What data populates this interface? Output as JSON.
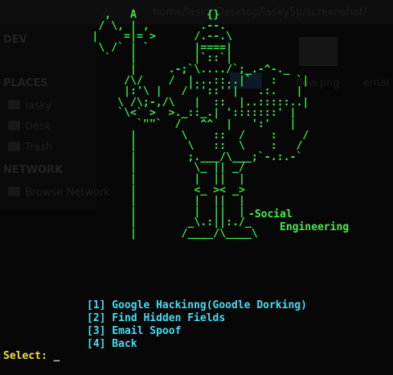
{
  "background_window": {
    "path_bar": "home/lasky/Desktop/lasky5p/screenshot/",
    "sections": [
      "DEV",
      "PLACES",
      "NETWORK"
    ],
    "items": [
      "lasky",
      "Desk",
      "Trash",
      "Browse Network"
    ],
    "files": [
      "flow.png",
      "emai"
    ]
  },
  "banner": {
    "art_lines": [
      "            ,   A           {}",
      "           / \\, | ,        .--.",
      "          |    =|= >      /.--.\\",
      "           \\ /` | `       |====|",
      "            `   |         |`::`|",
      "                |     .-;`\\..../`;_.-^-._",
      "               /\\/    /  |...::..|`   :   `|",
      "               |:'\\ |   /'''::''|   .:.   |",
      "              \\ /\\;-,/\\   |  ::  |..:::::..|",
      "              `\\<` >  >._::_.| ':::::::' |",
      "                 `\"\"`  /   ^^  |   ':'   |",
      "                |       \\    ::  /    :    /",
      "                |        \\   ::  \\    :   /",
      "                |        ;.___/\\___;`-.:.-`",
      "                |         \\_ || _/",
      "                |         |  ||  |",
      "                |         <_ >< _>",
      "                |         |  ||  |",
      "                |         |  ||  |",
      "                |        _\\.:||:./_",
      "                |       /____/\\____\\"
    ],
    "signature_prefix": "-Social",
    "signature_suffix": "Engineering"
  },
  "menu": {
    "items": [
      "[1] Google Hackinng(Goodle Dorking)",
      "[2] Find Hidden Fields",
      "[3] Email Spoof",
      "[4] Back"
    ]
  },
  "prompt": {
    "label": "Select:",
    "cursor": "_"
  },
  "colors": {
    "background": "#000000",
    "art": "#39e84a",
    "menu": "#46dcf2",
    "prompt": "#f2e03c"
  }
}
